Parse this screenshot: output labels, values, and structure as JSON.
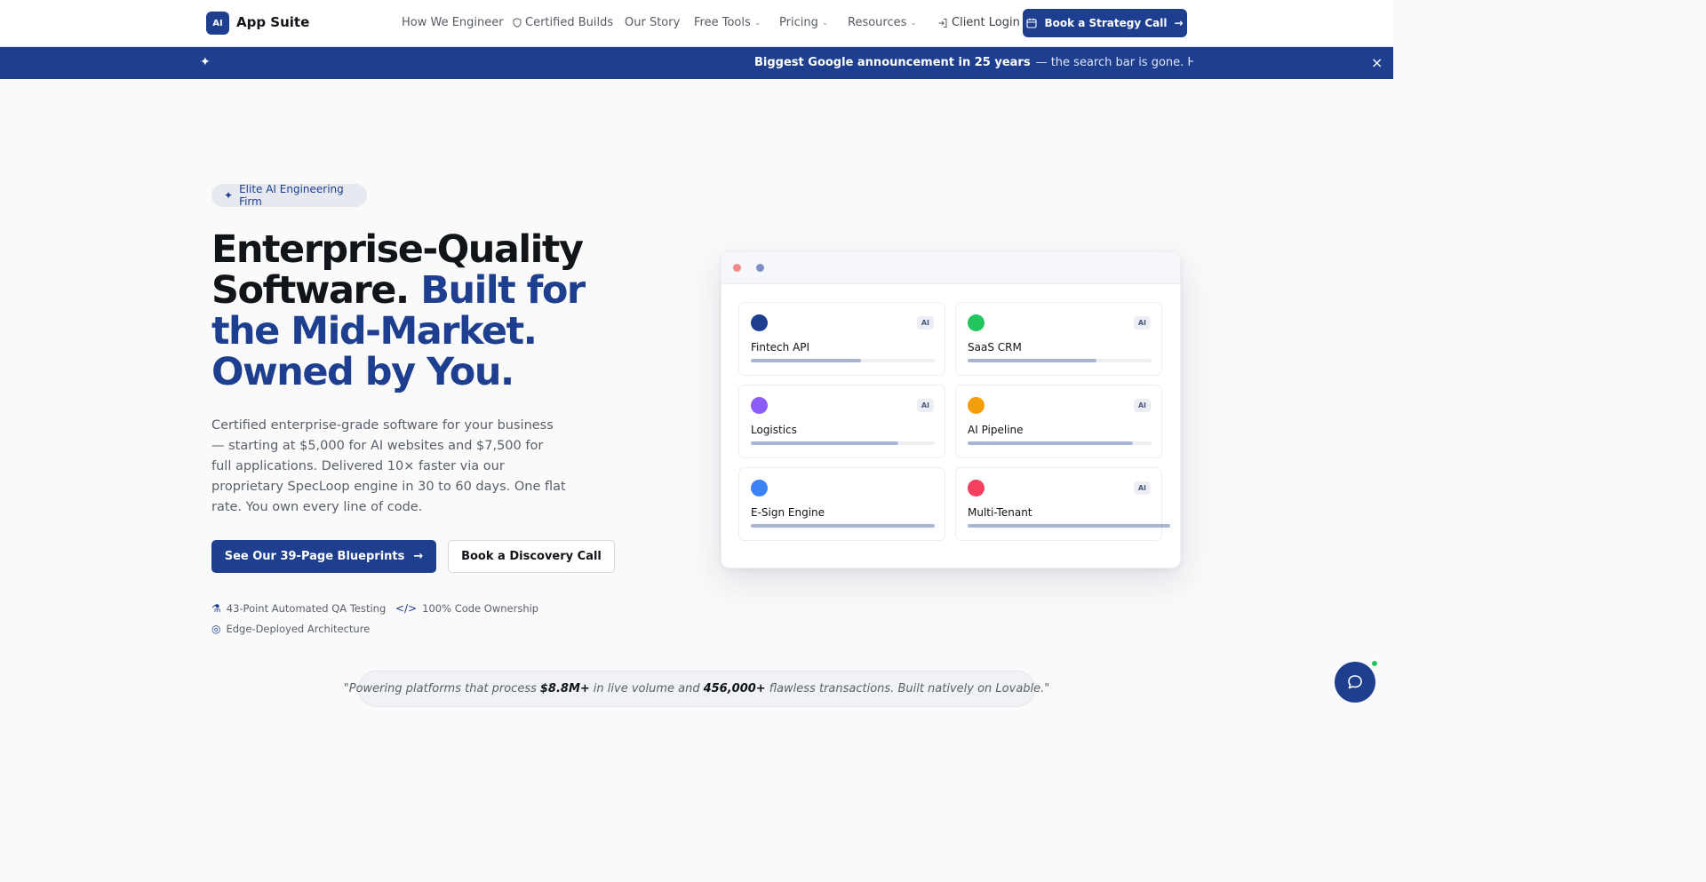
{
  "nav": {
    "logo_badge": "AI",
    "logo_text": "App Suite",
    "links": [
      "How We Engineer",
      "Certified Builds",
      "Our Story",
      "Free Tools",
      "Pricing",
      "Resources"
    ],
    "login": "Client Login",
    "cta": "Book a Strategy Call"
  },
  "banner": {
    "strong": "Biggest Google announcement in 25 years",
    "rest": "— the search bar is gone. Here's what"
  },
  "hero": {
    "badge": "Elite AI Engineering Firm",
    "headline_dark": "Enterprise-Quality Software.",
    "headline_accent": "Built for the Mid-Market. Owned by You.",
    "description": "Certified enterprise-grade software for your business — starting at $5,000 for AI websites and $7,500 for full applications. Delivered 10× faster via our proprietary SpecLoop engine in 30 to 60 days. One flat rate. You own every line of code.",
    "primary_button": "See Our 39-Page Blueprints",
    "secondary_button": "Book a Discovery Call",
    "features": [
      "43-Point Automated QA Testing",
      "100% Code Ownership",
      "Edge-Deployed Architecture"
    ]
  },
  "mock": {
    "cards": [
      {
        "label": "Fintech API",
        "color": "#1e3f8f",
        "ai": "AI",
        "progress": 0.6
      },
      {
        "label": "SaaS CRM",
        "color": "#22c55e",
        "ai": "AI",
        "progress": 0.7
      },
      {
        "label": "Logistics",
        "color": "#8b5cf6",
        "ai": "AI",
        "progress": 0.8
      },
      {
        "label": "AI Pipeline",
        "color": "#f59e0b",
        "ai": "AI",
        "progress": 0.9
      },
      {
        "label": "E-Sign Engine",
        "color": "#3b82f6",
        "ai": "",
        "progress": 1.0
      },
      {
        "label": "Multi-Tenant",
        "color": "#f43f5e",
        "ai": "AI",
        "progress": 1.1
      }
    ]
  },
  "quote": {
    "pre": "\"Powering platforms that process",
    "v1": "$8.8M+",
    "mid": "in live volume and",
    "v2": "456,000+",
    "post": "flawless transactions. Built natively on Lovable.\""
  }
}
